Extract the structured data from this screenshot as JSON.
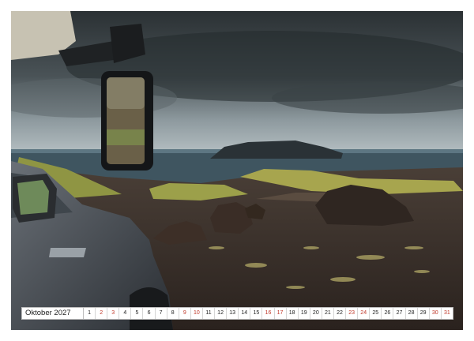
{
  "calendar": {
    "month_label": "Oktober 2027",
    "days": [
      "1",
      "2",
      "3",
      "4",
      "5",
      "6",
      "7",
      "8",
      "9",
      "10",
      "11",
      "12",
      "13",
      "14",
      "15",
      "16",
      "17",
      "18",
      "19",
      "20",
      "21",
      "22",
      "23",
      "24",
      "25",
      "26",
      "27",
      "28",
      "29",
      "30",
      "31"
    ],
    "weekend_days": [
      "2",
      "3",
      "9",
      "10",
      "16",
      "17",
      "23",
      "24",
      "30",
      "31"
    ]
  },
  "photo": {
    "subject": "landscape-with-vehicle-mirror",
    "colors": {
      "sky_dark": "#2d3336",
      "sky_light": "#aab4b8",
      "sea": "#3f5560",
      "ground": "#3a2f2a",
      "moss": "#9da14a",
      "car": "#4a4f55"
    }
  }
}
